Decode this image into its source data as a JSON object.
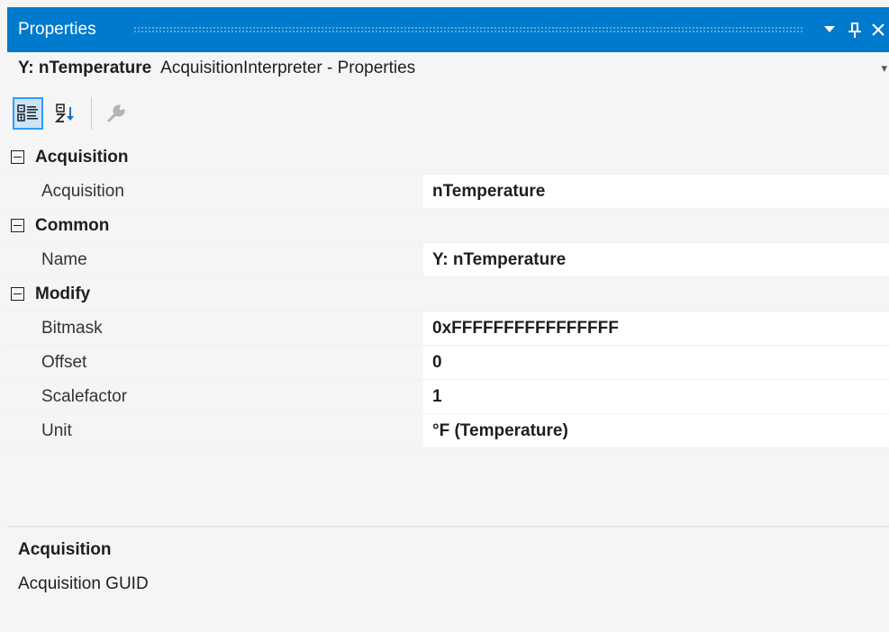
{
  "window": {
    "title": "Properties"
  },
  "selector": {
    "object_name": "Y: nTemperature",
    "object_type": "AcquisitionInterpreter - Properties"
  },
  "toolbar": {
    "categorized_icon": "categorized-icon",
    "alphabetical_icon": "alphabetical-sort-icon",
    "property_pages_icon": "wrench-icon"
  },
  "grid": {
    "categories": [
      {
        "label": "Acquisition",
        "properties": [
          {
            "name": "Acquisition",
            "value": "nTemperature"
          }
        ]
      },
      {
        "label": "Common",
        "properties": [
          {
            "name": "Name",
            "value": "Y: nTemperature"
          }
        ]
      },
      {
        "label": "Modify",
        "properties": [
          {
            "name": "Bitmask",
            "value": "0xFFFFFFFFFFFFFFFF"
          },
          {
            "name": "Offset",
            "value": "0"
          },
          {
            "name": "Scalefactor",
            "value": "1"
          },
          {
            "name": "Unit",
            "value": "°F (Temperature)"
          }
        ]
      }
    ]
  },
  "description": {
    "title": "Acquisition",
    "text": "Acquisition GUID"
  },
  "colors": {
    "titlebar": "#007acc",
    "selected_tool_border": "#3399ff"
  }
}
